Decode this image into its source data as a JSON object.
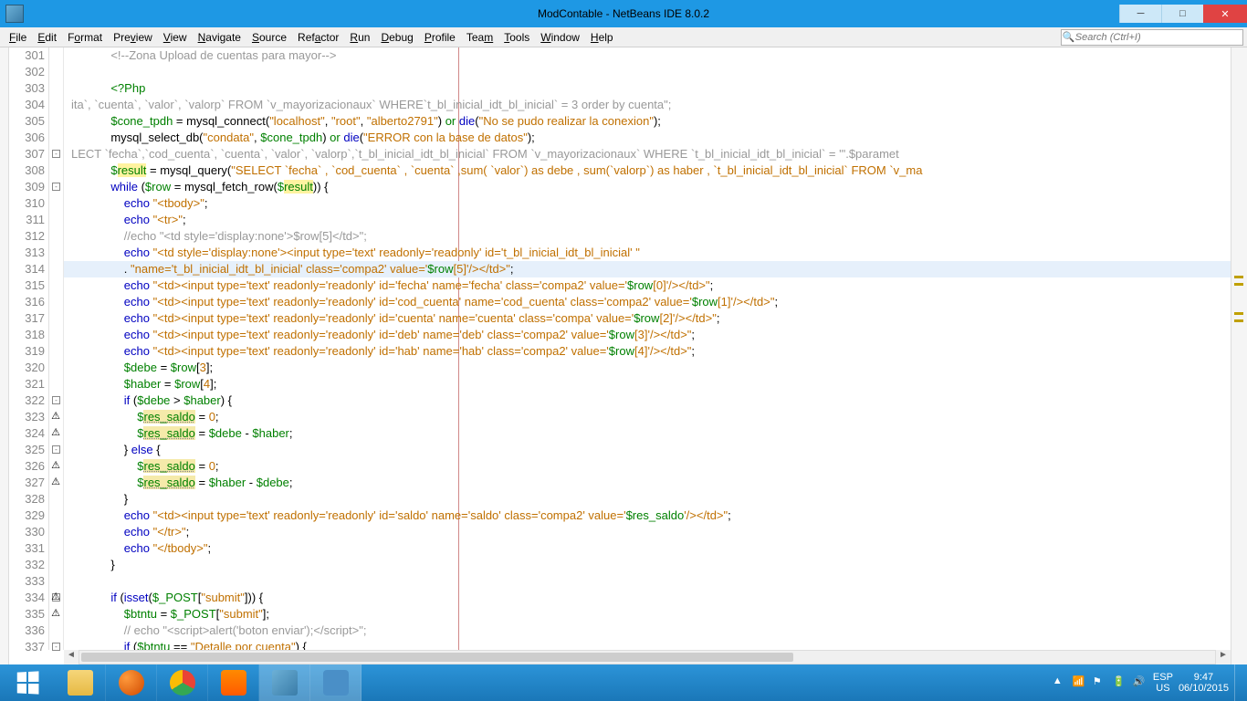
{
  "window": {
    "title": "ModContable - NetBeans IDE 8.0.2"
  },
  "menu": {
    "items": [
      {
        "u": "F",
        "rest": "ile"
      },
      {
        "u": "E",
        "rest": "dit"
      },
      {
        "u": "",
        "rest": "F",
        "u2": "o",
        "rest2": "rmat"
      },
      {
        "u": "",
        "rest": "Pre",
        "u2": "v",
        "rest2": "iew"
      },
      {
        "u": "V",
        "rest": "iew"
      },
      {
        "u": "N",
        "rest": "avigate"
      },
      {
        "u": "S",
        "rest": "ource"
      },
      {
        "u": "",
        "rest": "Ref",
        "u2": "a",
        "rest2": "ctor"
      },
      {
        "u": "R",
        "rest": "un"
      },
      {
        "u": "D",
        "rest": "ebug"
      },
      {
        "u": "",
        "rest": "",
        "u2": "P",
        "rest2": "rofile"
      },
      {
        "u": "",
        "rest": "Tea",
        "u2": "m",
        "rest2": ""
      },
      {
        "u": "T",
        "rest": "ools"
      },
      {
        "u": "W",
        "rest": "indow"
      },
      {
        "u": "H",
        "rest": "elp"
      }
    ],
    "search_placeholder": "Search (Ctrl+I)"
  },
  "code": {
    "first_line_no": 301,
    "highlight_line": 314,
    "lines": [
      {
        "n": 301,
        "indent": 3,
        "tokens": [
          {
            "t": "<!--Zona Upload de cuentas para mayor-->",
            "c": "tok-comment"
          }
        ]
      },
      {
        "n": 302,
        "indent": 0,
        "tokens": []
      },
      {
        "n": 303,
        "indent": 3,
        "tokens": [
          {
            "t": "<?Php",
            "c": "tok-green"
          }
        ]
      },
      {
        "n": 304,
        "indent": 0,
        "tokens": [
          {
            "t": "ita`, `cuenta`, `valor`, `valorp` FROM `v_mayorizacionaux` WHERE`t_bl_inicial_idt_bl_inicial` = 3 order by cuenta\";",
            "c": "tok-comment"
          }
        ]
      },
      {
        "n": 305,
        "indent": 3,
        "tokens": [
          {
            "t": "$cone_tpdh",
            "c": "tok-green"
          },
          {
            "t": " = "
          },
          {
            "t": "mysql_connect",
            "c": "tok-fn"
          },
          {
            "t": "("
          },
          {
            "t": "\"localhost\"",
            "c": "tok-str"
          },
          {
            "t": ", "
          },
          {
            "t": "\"root\"",
            "c": "tok-str"
          },
          {
            "t": ", "
          },
          {
            "t": "\"alberto2791\"",
            "c": "tok-str"
          },
          {
            "t": ") "
          },
          {
            "t": "or",
            "c": "tok-green"
          },
          {
            "t": " "
          },
          {
            "t": "die",
            "c": "tok-kw"
          },
          {
            "t": "("
          },
          {
            "t": "\"No se pudo realizar la conexion\"",
            "c": "tok-str"
          },
          {
            "t": ");"
          }
        ]
      },
      {
        "n": 306,
        "indent": 3,
        "tokens": [
          {
            "t": "mysql_select_db",
            "c": "tok-fn"
          },
          {
            "t": "("
          },
          {
            "t": "\"condata\"",
            "c": "tok-str"
          },
          {
            "t": ", "
          },
          {
            "t": "$cone_tpdh",
            "c": "tok-green"
          },
          {
            "t": ") "
          },
          {
            "t": "or",
            "c": "tok-green"
          },
          {
            "t": " "
          },
          {
            "t": "die",
            "c": "tok-kw"
          },
          {
            "t": "("
          },
          {
            "t": "\"ERROR con la base de datos\"",
            "c": "tok-str"
          },
          {
            "t": ");"
          }
        ]
      },
      {
        "n": 307,
        "glyph": "-",
        "indent": 0,
        "tokens": [
          {
            "t": "LECT `fecha`,`cod_cuenta`, `cuenta`, `valor`, `valorp`,`t_bl_inicial_idt_bl_inicial` FROM `v_mayorizacionaux` WHERE `t_bl_inicial_idt_bl_inicial` = '\".$paramet",
            "c": "tok-comment"
          }
        ]
      },
      {
        "n": 308,
        "indent": 3,
        "tokens": [
          {
            "t": "$",
            "c": "tok-green"
          },
          {
            "t": "result",
            "c": "tok-green hl-y"
          },
          {
            "t": " = "
          },
          {
            "t": "mysql_query",
            "c": "tok-fn"
          },
          {
            "t": "("
          },
          {
            "t": "\"SELECT `fecha` , `cod_cuenta` , `cuenta` ,sum( `valor`) as debe , sum(`valorp`) as haber , `t_bl_inicial_idt_bl_inicial` FROM `v_ma",
            "c": "tok-str"
          }
        ]
      },
      {
        "n": 309,
        "glyph": "-",
        "indent": 3,
        "tokens": [
          {
            "t": "while",
            "c": "tok-kw"
          },
          {
            "t": " ("
          },
          {
            "t": "$row",
            "c": "tok-green"
          },
          {
            "t": " = "
          },
          {
            "t": "mysql_fetch_row",
            "c": "tok-fn"
          },
          {
            "t": "("
          },
          {
            "t": "$",
            "c": "tok-green"
          },
          {
            "t": "result",
            "c": "tok-green hl-y"
          },
          {
            "t": ")) {"
          }
        ]
      },
      {
        "n": 310,
        "indent": 4,
        "tokens": [
          {
            "t": "echo",
            "c": "tok-kw"
          },
          {
            "t": " "
          },
          {
            "t": "\"<tbody>\"",
            "c": "tok-str"
          },
          {
            "t": ";"
          }
        ]
      },
      {
        "n": 311,
        "indent": 4,
        "tokens": [
          {
            "t": "echo",
            "c": "tok-kw"
          },
          {
            "t": " "
          },
          {
            "t": "\"<tr>\"",
            "c": "tok-str"
          },
          {
            "t": ";"
          }
        ]
      },
      {
        "n": 312,
        "indent": 4,
        "tokens": [
          {
            "t": "//echo \"<td style='display:none'>$row[5]</td>\";",
            "c": "tok-comment"
          }
        ]
      },
      {
        "n": 313,
        "indent": 4,
        "tokens": [
          {
            "t": "echo",
            "c": "tok-kw"
          },
          {
            "t": " "
          },
          {
            "t": "\"<td style='display:none'><input type='text' readonly='readonly' id='t_bl_inicial_idt_bl_inicial' \"",
            "c": "tok-str"
          }
        ]
      },
      {
        "n": 314,
        "hl": true,
        "indent": 4,
        "tokens": [
          {
            "t": ". "
          },
          {
            "t": "\"name='t_bl_inicial_idt_bl_inicial' class='compa2' value='",
            "c": "tok-str"
          },
          {
            "t": "$row",
            "c": "tok-green"
          },
          {
            "t": "[",
            "c": "tok-str"
          },
          {
            "t": "5",
            "c": "tok-str"
          },
          {
            "t": "]",
            "c": "tok-str"
          },
          {
            "t": "'/></td>\"",
            "c": "tok-str"
          },
          {
            "t": ";"
          }
        ]
      },
      {
        "n": 315,
        "indent": 4,
        "tokens": [
          {
            "t": "echo",
            "c": "tok-kw"
          },
          {
            "t": " "
          },
          {
            "t": "\"<td><input type='text' readonly='readonly' id='fecha' name='fecha' class='compa2' value='",
            "c": "tok-str"
          },
          {
            "t": "$row",
            "c": "tok-green"
          },
          {
            "t": "[",
            "c": "tok-str"
          },
          {
            "t": "0",
            "c": "tok-str"
          },
          {
            "t": "]",
            "c": "tok-str"
          },
          {
            "t": "'/></td>\"",
            "c": "tok-str"
          },
          {
            "t": ";"
          }
        ]
      },
      {
        "n": 316,
        "indent": 4,
        "tokens": [
          {
            "t": "echo",
            "c": "tok-kw"
          },
          {
            "t": " "
          },
          {
            "t": "\"<td><input type='text' readonly='readonly' id='cod_cuenta' name='cod_cuenta' class='compa2' value='",
            "c": "tok-str"
          },
          {
            "t": "$row",
            "c": "tok-green"
          },
          {
            "t": "[",
            "c": "tok-str"
          },
          {
            "t": "1",
            "c": "tok-str"
          },
          {
            "t": "]",
            "c": "tok-str"
          },
          {
            "t": "'/></td>\"",
            "c": "tok-str"
          },
          {
            "t": ";"
          }
        ]
      },
      {
        "n": 317,
        "indent": 4,
        "tokens": [
          {
            "t": "echo",
            "c": "tok-kw"
          },
          {
            "t": " "
          },
          {
            "t": "\"<td><input type='text' readonly='readonly' id='cuenta' name='cuenta' class='compa' value='",
            "c": "tok-str"
          },
          {
            "t": "$row",
            "c": "tok-green"
          },
          {
            "t": "[",
            "c": "tok-str"
          },
          {
            "t": "2",
            "c": "tok-str"
          },
          {
            "t": "]",
            "c": "tok-str"
          },
          {
            "t": "'/></td>\"",
            "c": "tok-str"
          },
          {
            "t": ";"
          }
        ]
      },
      {
        "n": 318,
        "indent": 4,
        "tokens": [
          {
            "t": "echo",
            "c": "tok-kw"
          },
          {
            "t": " "
          },
          {
            "t": "\"<td><input type='text' readonly='readonly' id='deb' name='deb' class='compa2' value='",
            "c": "tok-str"
          },
          {
            "t": "$row",
            "c": "tok-green"
          },
          {
            "t": "[",
            "c": "tok-str"
          },
          {
            "t": "3",
            "c": "tok-str"
          },
          {
            "t": "]",
            "c": "tok-str"
          },
          {
            "t": "'/></td>\"",
            "c": "tok-str"
          },
          {
            "t": ";"
          }
        ]
      },
      {
        "n": 319,
        "indent": 4,
        "tokens": [
          {
            "t": "echo",
            "c": "tok-kw"
          },
          {
            "t": " "
          },
          {
            "t": "\"<td><input type='text' readonly='readonly' id='hab' name='hab' class='compa2' value='",
            "c": "tok-str"
          },
          {
            "t": "$row",
            "c": "tok-green"
          },
          {
            "t": "[",
            "c": "tok-str"
          },
          {
            "t": "4",
            "c": "tok-str"
          },
          {
            "t": "]",
            "c": "tok-str"
          },
          {
            "t": "'/></td>\"",
            "c": "tok-str"
          },
          {
            "t": ";"
          }
        ]
      },
      {
        "n": 320,
        "indent": 4,
        "tokens": [
          {
            "t": "$debe",
            "c": "tok-green"
          },
          {
            "t": " = "
          },
          {
            "t": "$row",
            "c": "tok-green"
          },
          {
            "t": "["
          },
          {
            "t": "3",
            "c": "tok-str"
          },
          {
            "t": "];"
          }
        ]
      },
      {
        "n": 321,
        "indent": 4,
        "tokens": [
          {
            "t": "$haber",
            "c": "tok-green"
          },
          {
            "t": " = "
          },
          {
            "t": "$row",
            "c": "tok-green"
          },
          {
            "t": "["
          },
          {
            "t": "4",
            "c": "tok-str"
          },
          {
            "t": "];"
          }
        ]
      },
      {
        "n": 322,
        "glyph": "-",
        "indent": 4,
        "tokens": [
          {
            "t": "if",
            "c": "tok-kw"
          },
          {
            "t": " ("
          },
          {
            "t": "$debe",
            "c": "tok-green"
          },
          {
            "t": " > "
          },
          {
            "t": "$haber",
            "c": "tok-green"
          },
          {
            "t": ") {"
          }
        ]
      },
      {
        "n": 323,
        "warn": true,
        "indent": 5,
        "tokens": [
          {
            "t": "$",
            "c": "tok-green"
          },
          {
            "t": "res_saldo",
            "c": "tok-green hl-u"
          },
          {
            "t": " = "
          },
          {
            "t": "0",
            "c": "tok-str"
          },
          {
            "t": ";"
          }
        ]
      },
      {
        "n": 324,
        "warn": true,
        "indent": 5,
        "tokens": [
          {
            "t": "$",
            "c": "tok-green"
          },
          {
            "t": "res_saldo",
            "c": "tok-green hl-u"
          },
          {
            "t": " = "
          },
          {
            "t": "$debe",
            "c": "tok-green"
          },
          {
            "t": " - "
          },
          {
            "t": "$haber",
            "c": "tok-green"
          },
          {
            "t": ";"
          }
        ]
      },
      {
        "n": 325,
        "glyph": "-",
        "indent": 4,
        "tokens": [
          {
            "t": "} "
          },
          {
            "t": "else",
            "c": "tok-kw"
          },
          {
            "t": " {"
          }
        ]
      },
      {
        "n": 326,
        "warn": true,
        "indent": 5,
        "tokens": [
          {
            "t": "$",
            "c": "tok-green"
          },
          {
            "t": "res_saldo",
            "c": "tok-green hl-u"
          },
          {
            "t": " = "
          },
          {
            "t": "0",
            "c": "tok-str"
          },
          {
            "t": ";"
          }
        ]
      },
      {
        "n": 327,
        "warn": true,
        "indent": 5,
        "tokens": [
          {
            "t": "$",
            "c": "tok-green"
          },
          {
            "t": "res_saldo",
            "c": "tok-green hl-u"
          },
          {
            "t": " = "
          },
          {
            "t": "$haber",
            "c": "tok-green"
          },
          {
            "t": " - "
          },
          {
            "t": "$debe",
            "c": "tok-green"
          },
          {
            "t": ";"
          }
        ]
      },
      {
        "n": 328,
        "indent": 4,
        "tokens": [
          {
            "t": "}"
          }
        ]
      },
      {
        "n": 329,
        "indent": 4,
        "tokens": [
          {
            "t": "echo",
            "c": "tok-kw"
          },
          {
            "t": " "
          },
          {
            "t": "\"<td><input type='text' readonly='readonly' id='saldo' name='saldo' class='compa2' value='",
            "c": "tok-str"
          },
          {
            "t": "$res_saldo",
            "c": "tok-green"
          },
          {
            "t": "'/></td>\"",
            "c": "tok-str"
          },
          {
            "t": ";"
          }
        ]
      },
      {
        "n": 330,
        "indent": 4,
        "tokens": [
          {
            "t": "echo",
            "c": "tok-kw"
          },
          {
            "t": " "
          },
          {
            "t": "\"</tr>\"",
            "c": "tok-str"
          },
          {
            "t": ";"
          }
        ]
      },
      {
        "n": 331,
        "indent": 4,
        "tokens": [
          {
            "t": "echo",
            "c": "tok-kw"
          },
          {
            "t": " "
          },
          {
            "t": "\"</tbody>\"",
            "c": "tok-str"
          },
          {
            "t": ";"
          }
        ]
      },
      {
        "n": 332,
        "indent": 3,
        "tokens": [
          {
            "t": "}"
          }
        ]
      },
      {
        "n": 333,
        "indent": 0,
        "tokens": []
      },
      {
        "n": 334,
        "glyph": "-",
        "warn": true,
        "indent": 3,
        "tokens": [
          {
            "t": "if",
            "c": "tok-kw"
          },
          {
            "t": " ("
          },
          {
            "t": "isset",
            "c": "tok-kw"
          },
          {
            "t": "("
          },
          {
            "t": "$_POST",
            "c": "tok-green"
          },
          {
            "t": "["
          },
          {
            "t": "\"submit\"",
            "c": "tok-str"
          },
          {
            "t": "])) {"
          }
        ]
      },
      {
        "n": 335,
        "warn": true,
        "indent": 4,
        "tokens": [
          {
            "t": "$btntu",
            "c": "tok-green"
          },
          {
            "t": " = "
          },
          {
            "t": "$_POST",
            "c": "tok-green"
          },
          {
            "t": "["
          },
          {
            "t": "\"submit\"",
            "c": "tok-str"
          },
          {
            "t": "];"
          }
        ]
      },
      {
        "n": 336,
        "indent": 4,
        "tokens": [
          {
            "t": "// echo \"<script>alert('boton enviar');</script>\";",
            "c": "tok-comment"
          }
        ]
      },
      {
        "n": 337,
        "glyph": "-",
        "indent": 4,
        "tokens": [
          {
            "t": "if",
            "c": "tok-kw"
          },
          {
            "t": " ("
          },
          {
            "t": "$btntu",
            "c": "tok-green"
          },
          {
            "t": " == "
          },
          {
            "t": "\"Detalle por cuenta\"",
            "c": "tok-str"
          },
          {
            "t": ") {"
          }
        ]
      }
    ]
  },
  "taskbar": {
    "lang": "ESP",
    "kbd": "US",
    "time": "9:47",
    "date": "06/10/2015"
  }
}
